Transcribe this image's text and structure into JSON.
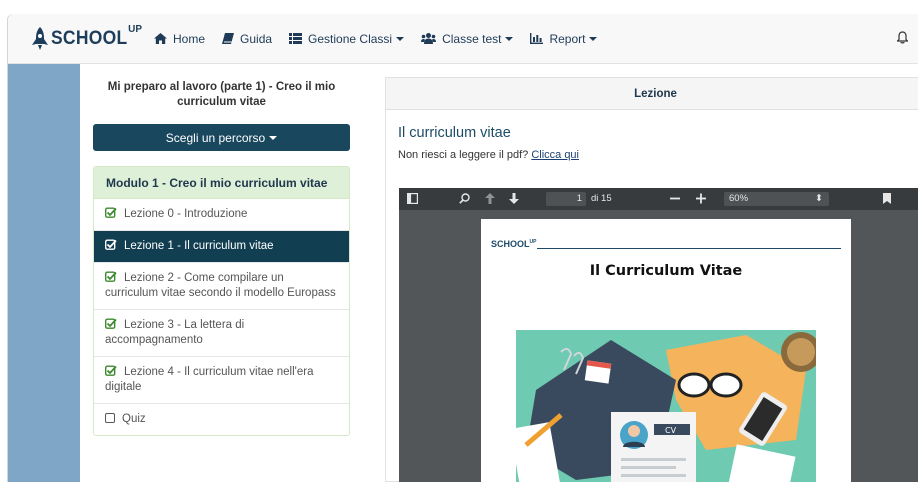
{
  "brand": {
    "name": "SCHOOL",
    "sup": "UP"
  },
  "nav": {
    "home": "Home",
    "guide": "Guida",
    "classes": "Gestione Classi",
    "class_test": "Classe test",
    "report": "Report"
  },
  "sidebar": {
    "course_title": "Mi preparo al lavoro (parte 1) - Creo il mio curriculum vitae",
    "path_button": "Scegli un percorso",
    "module_title": "Modulo 1 - Creo il mio curriculum vitae",
    "lessons": [
      {
        "label": "Lezione 0 - Introduzione",
        "done": true,
        "active": false
      },
      {
        "label": "Lezione 1 - Il curriculum vitae",
        "done": true,
        "active": true
      },
      {
        "label": "Lezione 2 - Come compilare un curriculum vitae secondo il modello Europass",
        "done": true,
        "active": false
      },
      {
        "label": "Lezione 3 - La lettera di accompagnamento",
        "done": true,
        "active": false
      },
      {
        "label": "Lezione 4 - Il curriculum vitae nell'era digitale",
        "done": true,
        "active": false
      },
      {
        "label": "Quiz",
        "done": false,
        "active": false
      }
    ]
  },
  "content": {
    "panel_title": "Lezione",
    "lesson_title": "Il curriculum vitae",
    "pdf_prompt": "Non riesci a leggere il pdf?",
    "pdf_link": "Clicca qui"
  },
  "viewer": {
    "page_number": "1",
    "page_of": "di 15",
    "zoom": "60%",
    "doc_logo": "SCHOOL",
    "doc_logo_sup": "UP",
    "doc_title": "Il Curriculum Vitae",
    "cv_tag": "CV"
  },
  "colors": {
    "brand": "#1e3d5a",
    "primary": "#18475e",
    "active_lesson": "#123e52",
    "module_header": "#dff0d8",
    "check": "#3c8a2e",
    "stripe": "#7fa6c6"
  }
}
